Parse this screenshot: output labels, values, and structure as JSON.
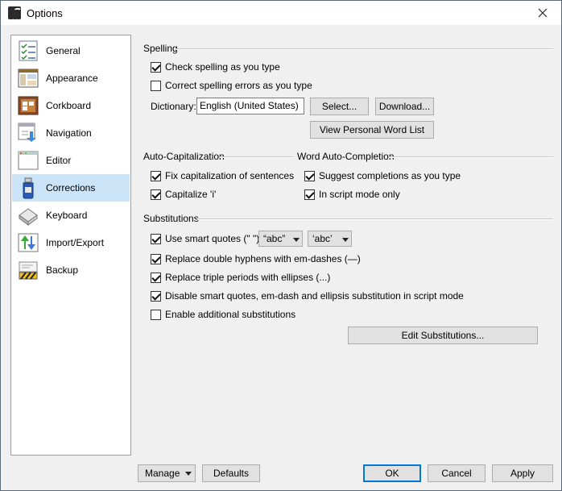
{
  "window": {
    "title": "Options"
  },
  "sidebar": {
    "items": [
      {
        "label": "General",
        "icon": "checklist-icon"
      },
      {
        "label": "Appearance",
        "icon": "window-layout-icon"
      },
      {
        "label": "Corkboard",
        "icon": "corkboard-icon"
      },
      {
        "label": "Navigation",
        "icon": "navigation-arrows-icon"
      },
      {
        "label": "Editor",
        "icon": "blank-window-icon"
      },
      {
        "label": "Corrections",
        "icon": "spellcheck-bottle-icon",
        "selected": true
      },
      {
        "label": "Keyboard",
        "icon": "keyboard-key-icon"
      },
      {
        "label": "Import/Export",
        "icon": "import-export-arrows-icon"
      },
      {
        "label": "Backup",
        "icon": "backup-archive-icon"
      }
    ]
  },
  "spelling": {
    "title": "Spelling",
    "check_as_you_type": {
      "label": "Check spelling as you type",
      "checked": true
    },
    "correct_errors": {
      "label": "Correct spelling errors as you type",
      "checked": false
    },
    "dictionary_label": "Dictionary:",
    "dictionary_value": "English (United States)",
    "select_button": "Select...",
    "download_button": "Download...",
    "view_word_list_button": "View Personal Word List"
  },
  "auto_capitalization": {
    "title": "Auto-Capitalization",
    "fix_sentences": {
      "label": "Fix capitalization of sentences",
      "checked": true
    },
    "capitalize_i": {
      "label": "Capitalize 'i'",
      "checked": true
    }
  },
  "word_auto_completion": {
    "title": "Word Auto-Completion",
    "suggest": {
      "label": "Suggest completions as you type",
      "checked": true
    },
    "script_mode": {
      "label": "In script mode only",
      "checked": true
    }
  },
  "substitutions": {
    "title": "Substitutions",
    "smart_quotes": {
      "label": "Use smart quotes (\" \")",
      "checked": true
    },
    "double_quote_style": "“abc”",
    "single_quote_style": "‘abc’",
    "em_dashes": {
      "label": "Replace double hyphens with em-dashes (—)",
      "checked": true
    },
    "ellipses": {
      "label": "Replace triple periods with ellipses (...)",
      "checked": true
    },
    "disable_script": {
      "label": "Disable smart quotes, em-dash and ellipsis substitution in script mode",
      "checked": true
    },
    "enable_additional": {
      "label": "Enable additional substitutions",
      "checked": false
    },
    "edit_button": "Edit Substitutions..."
  },
  "footer": {
    "manage": "Manage",
    "defaults": "Defaults",
    "ok": "OK",
    "cancel": "Cancel",
    "apply": "Apply"
  },
  "colors": {
    "selection": "#cce4f7",
    "default_button_border": "#0078d7"
  }
}
